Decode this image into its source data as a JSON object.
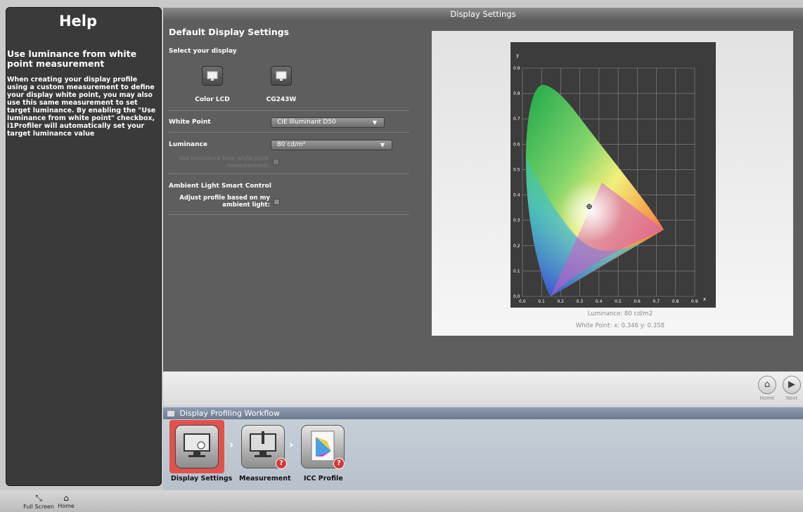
{
  "help": {
    "title": "Help",
    "subtitle": "Use luminance from white point measurement",
    "body": "When creating your display profile using a custom measurement to define your display white point, you may also use this same measurement to set target luminance. By enabling the \"Use luminance from white point\" checkbox, i1Profiler will automatically set your target luminance value"
  },
  "window": {
    "title": "Display Settings"
  },
  "settings": {
    "heading": "Default Display Settings",
    "select_display_label": "Select your display",
    "displays": [
      {
        "name": "Color LCD"
      },
      {
        "name": "CG243W"
      }
    ],
    "white_point_label": "White Point",
    "white_point_value": "CIE Illuminant D50",
    "luminance_label": "Luminance",
    "luminance_value": "80 cd/m²",
    "use_luminance_checkbox_label": "Use luminance from white point measurements",
    "ambient_heading": "Ambient Light Smart Control",
    "ambient_checkbox_label": "Adjust profile based on my ambient light:"
  },
  "chart": {
    "y_label": "y",
    "x_label": "x",
    "x_ticks": [
      "0.0",
      "0.1",
      "0.2",
      "0.3",
      "0.4",
      "0.5",
      "0.6",
      "0.7",
      "0.8",
      "0.9"
    ],
    "y_ticks": [
      "0.0",
      "0.1",
      "0.2",
      "0.3",
      "0.4",
      "0.5",
      "0.6",
      "0.7",
      "0.8",
      "0.9"
    ],
    "luminance_text": "Luminance:  80 cd/m2",
    "white_point_text": "White Point:  x: 0.346  y: 0.358"
  },
  "nav": {
    "home_label": "Home",
    "next_label": "Next"
  },
  "workflow": {
    "title": "Display Profiling Workflow",
    "steps": [
      {
        "label": "Display Settings"
      },
      {
        "label": "Measurement"
      },
      {
        "label": "ICC Profile"
      }
    ]
  },
  "toolbar": {
    "fullscreen_label": "Full Screen",
    "home_label": "Home"
  },
  "colors": {
    "panel_bg": "#5e5e5e",
    "help_bg": "#3a3a3a",
    "active_step": "#d9534f",
    "workflow_header": "#7a879b"
  }
}
